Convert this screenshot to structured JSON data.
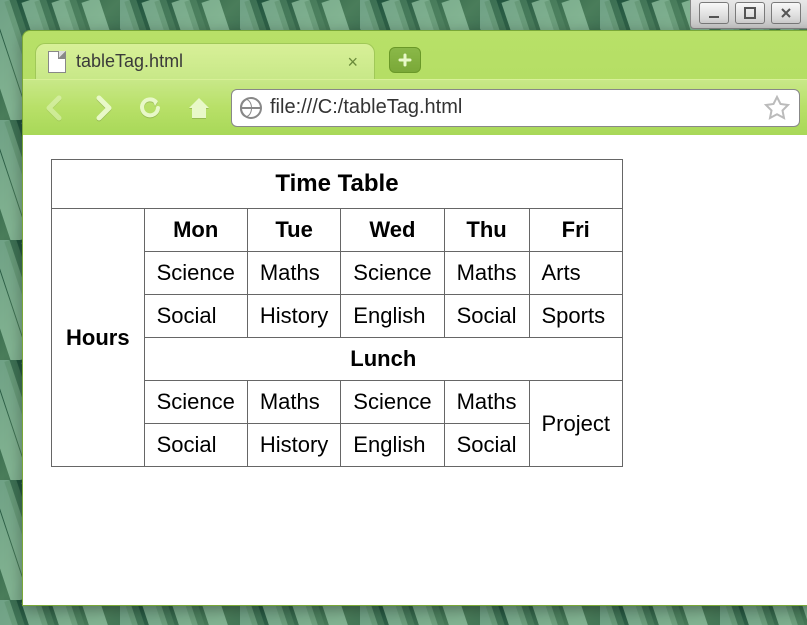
{
  "window": {
    "tab_title": "tableTag.html",
    "url": "file:///C:/tableTag.html"
  },
  "icons": {
    "nav_back": "back",
    "nav_forward": "forward",
    "nav_reload": "reload",
    "nav_home": "home",
    "bookmark_star": "star",
    "new_tab_plus": "+",
    "tab_close": "×",
    "minimize": "–",
    "maximize": "▢",
    "close": "×"
  },
  "timetable": {
    "title": "Time Table",
    "row_header": "Hours",
    "days": [
      "Mon",
      "Tue",
      "Wed",
      "Thu",
      "Fri"
    ],
    "rows": [
      [
        "Science",
        "Maths",
        "Science",
        "Maths",
        "Arts"
      ],
      [
        "Social",
        "History",
        "English",
        "Social",
        "Sports"
      ]
    ],
    "lunch_label": "Lunch",
    "rows_after": [
      [
        "Science",
        "Maths",
        "Science",
        "Maths"
      ],
      [
        "Social",
        "History",
        "English",
        "Social"
      ]
    ],
    "project_label": "Project"
  }
}
